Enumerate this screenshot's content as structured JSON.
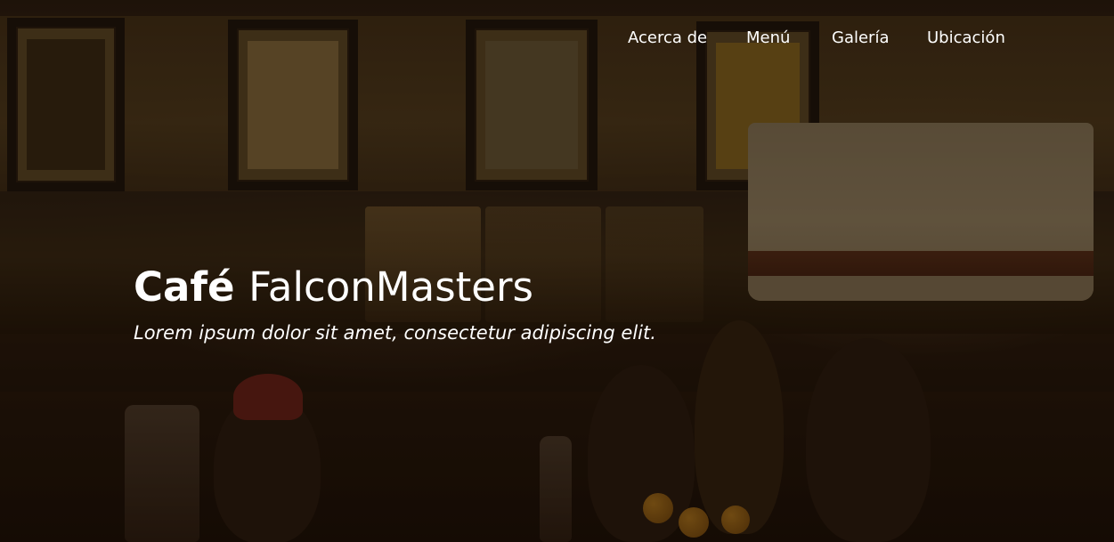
{
  "nav": {
    "items": [
      {
        "label": "Acerca de"
      },
      {
        "label": "Menú"
      },
      {
        "label": "Galería"
      },
      {
        "label": "Ubicación"
      }
    ]
  },
  "hero": {
    "title_bold": "Café",
    "title_rest": "FalconMasters",
    "subtitle": "Lorem ipsum dolor sit amet, consectetur adipiscing elit.",
    "background": "dark warm café interior photo",
    "colors": {
      "text": "#ffffff",
      "overlay": "#1a0f08"
    }
  }
}
